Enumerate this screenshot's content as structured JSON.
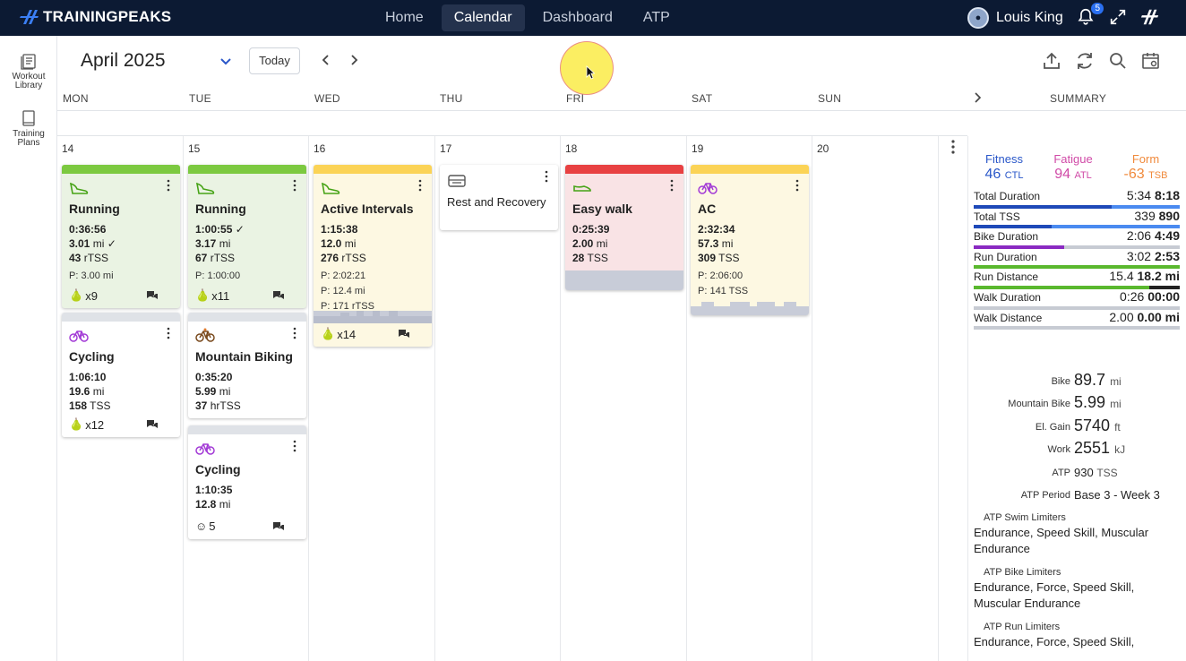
{
  "app": {
    "brand": "TRAININGPEAKS",
    "nav": [
      {
        "label": "Home",
        "active": false
      },
      {
        "label": "Calendar",
        "active": true
      },
      {
        "label": "Dashboard",
        "active": false
      },
      {
        "label": "ATP",
        "active": false
      }
    ],
    "user_name": "Louis King",
    "notification_count": "5"
  },
  "sidebar": {
    "workout_library": [
      "Workout",
      "Library"
    ],
    "training_plans": [
      "Training",
      "Plans"
    ]
  },
  "toolbar": {
    "month": "April 2025",
    "today_label": "Today"
  },
  "days": {
    "headers": [
      "MON",
      "TUE",
      "WED",
      "THU",
      "FRI",
      "SAT",
      "SUN"
    ],
    "summary_header": "SUMMARY",
    "dates": [
      "14",
      "15",
      "16",
      "17",
      "18",
      "19",
      "20"
    ]
  },
  "workouts": {
    "mon_run": {
      "title": "Running",
      "duration": "0:36:56",
      "distance": "3.01",
      "distance_unit": "mi",
      "tss": "43",
      "tss_unit": "rTSS",
      "planned": "P: 3.00 mi",
      "foot_count": "x9",
      "color": "#7cc940"
    },
    "mon_cycle": {
      "title": "Cycling",
      "duration": "1:06:10",
      "distance": "19.6",
      "distance_unit": "mi",
      "tss": "158",
      "tss_unit": "TSS",
      "foot_count": "x12"
    },
    "tue_run": {
      "title": "Running",
      "duration": "1:00:55",
      "distance": "3.17",
      "distance_unit": "mi",
      "tss": "67",
      "tss_unit": "rTSS",
      "planned": "P: 1:00:00",
      "foot_count": "x11"
    },
    "tue_mtb": {
      "title": "Mountain Biking",
      "duration": "0:35:20",
      "distance": "5.99",
      "distance_unit": "mi",
      "tss": "37",
      "tss_unit": "hrTSS"
    },
    "tue_cycle": {
      "title": "Cycling",
      "duration": "1:10:35",
      "distance": "12.8",
      "distance_unit": "mi",
      "foot_count": "5"
    },
    "wed_intervals": {
      "title": "Active Intervals",
      "duration": "1:15:38",
      "distance": "12.0",
      "distance_unit": "mi",
      "tss": "276",
      "tss_unit": "rTSS",
      "planned1": "P: 2:02:21",
      "planned2": "P: 12.4 mi",
      "planned3": "P: 171 rTSS",
      "foot_count": "x14"
    },
    "thu_rest": {
      "title": "Rest and Recovery"
    },
    "fri_walk": {
      "title": "Easy walk",
      "duration": "0:25:39",
      "distance": "2.00",
      "distance_unit": "mi",
      "tss": "28",
      "tss_unit": "TSS"
    },
    "sat_ac": {
      "title": "AC",
      "duration": "2:32:34",
      "distance": "57.3",
      "distance_unit": "mi",
      "tss": "309",
      "tss_unit": "TSS",
      "planned1": "P: 2:06:00",
      "planned2": "P: 141 TSS"
    }
  },
  "summary": {
    "fitness": {
      "label": "Fitness",
      "value": "46",
      "unit": "CTL",
      "color": "#2a57c9"
    },
    "fatigue": {
      "label": "Fatigue",
      "value": "94",
      "unit": "ATL",
      "color": "#d04aa7"
    },
    "form": {
      "label": "Form",
      "value": "-63",
      "unit": "TSB",
      "color": "#f08a3c"
    },
    "bars": [
      {
        "name": "Total Duration",
        "done": "5:34",
        "planned": "8:18",
        "ratio": 0.67,
        "color": "#1e49b8",
        "plan_color": "#4a8af0"
      },
      {
        "name": "Total TSS",
        "done": "339",
        "planned": "890",
        "ratio": 0.38,
        "color": "#1e49b8",
        "plan_color": "#4a8af0"
      },
      {
        "name": "Bike Duration",
        "done": "2:06",
        "planned": "4:49",
        "ratio": 0.44,
        "color": "#8a2ac2",
        "plan_color": "#c7cbd3"
      },
      {
        "name": "Run Duration",
        "done": "3:02",
        "planned": "2:53",
        "ratio": 1.0,
        "color": "#5ab82e",
        "plan_color": "#5ab82e"
      },
      {
        "name": "Run Distance",
        "done": "15.4",
        "planned": "18.2 mi",
        "ratio": 0.85,
        "color": "#5ab82e",
        "plan_color": "#222222"
      },
      {
        "name": "Walk Duration",
        "done": "0:26",
        "planned": "00:00",
        "ratio": 1.0,
        "color": "#c7cbd3",
        "plan_color": "#c7cbd3"
      },
      {
        "name": "Walk Distance",
        "done": "2.00",
        "planned": "0.00 mi",
        "ratio": 1.0,
        "color": "#c7cbd3",
        "plan_color": "#c7cbd3"
      }
    ],
    "stats": [
      {
        "k": "Bike",
        "v": "89.7",
        "u": "mi"
      },
      {
        "k": "Mountain Bike",
        "v": "5.99",
        "u": "mi"
      },
      {
        "k": "El. Gain",
        "v": "5740",
        "u": "ft"
      },
      {
        "k": "Work",
        "v": "2551",
        "u": "kJ"
      },
      {
        "k": "ATP",
        "v": "930",
        "u": "TSS"
      },
      {
        "k": "ATP Period",
        "v": "Base 3 - Week 3",
        "u": ""
      }
    ],
    "limiters": [
      {
        "k": "ATP Swim Limiters",
        "t": "Endurance, Speed Skill, Muscular Endurance"
      },
      {
        "k": "ATP Bike Limiters",
        "t": "Endurance, Force, Speed Skill, Muscular Endurance"
      },
      {
        "k": "ATP Run Limiters",
        "t": "Endurance, Force, Speed Skill,"
      }
    ]
  }
}
